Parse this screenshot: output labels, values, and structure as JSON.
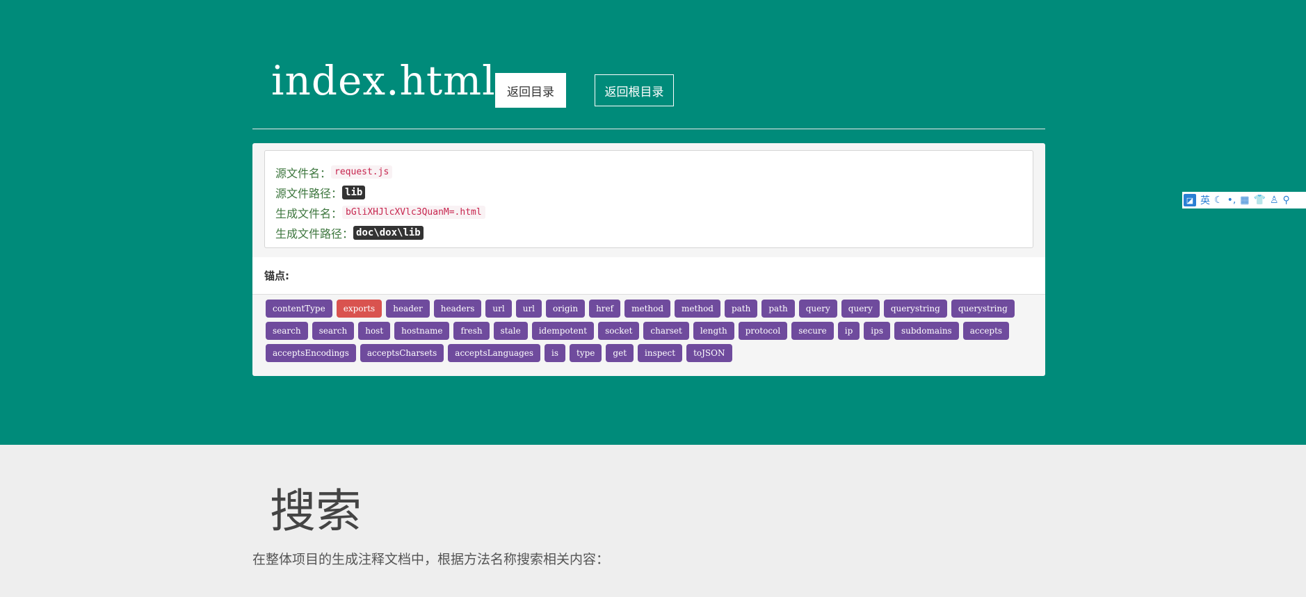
{
  "header": {
    "title": "index.html",
    "back_label": "返回目录",
    "root_label": "返回根目录"
  },
  "info": {
    "source_name_label": "源文件名：",
    "source_name": "request.js",
    "source_path_label": "源文件路径：",
    "source_path": "lib",
    "gen_name_label": "生成文件名：",
    "gen_name": "bGliXHJlcXVlc3QuanM=.html",
    "gen_path_label": "生成文件路径：",
    "gen_path": "doc\\dox\\lib"
  },
  "anchors": {
    "label": "锚点:",
    "active": "exports",
    "items": [
      "contentType",
      "exports",
      "header",
      "headers",
      "url",
      "url",
      "origin",
      "href",
      "method",
      "method",
      "path",
      "path",
      "query",
      "query",
      "querystring",
      "querystring",
      "search",
      "search",
      "host",
      "hostname",
      "fresh",
      "stale",
      "idempotent",
      "socket",
      "charset",
      "length",
      "protocol",
      "secure",
      "ip",
      "ips",
      "subdomains",
      "accepts",
      "acceptsEncodings",
      "acceptsCharsets",
      "acceptsLanguages",
      "is",
      "type",
      "get",
      "inspect",
      "toJSON"
    ]
  },
  "search": {
    "title": "搜索",
    "description": "在整体项目的生成注释文档中，根据方法名称搜索相关内容："
  },
  "ime": {
    "language": "英",
    "icons": [
      "moon-icon",
      "punctuation-icon",
      "keyboard-icon",
      "skin-icon",
      "user-icon",
      "search-icon"
    ]
  }
}
